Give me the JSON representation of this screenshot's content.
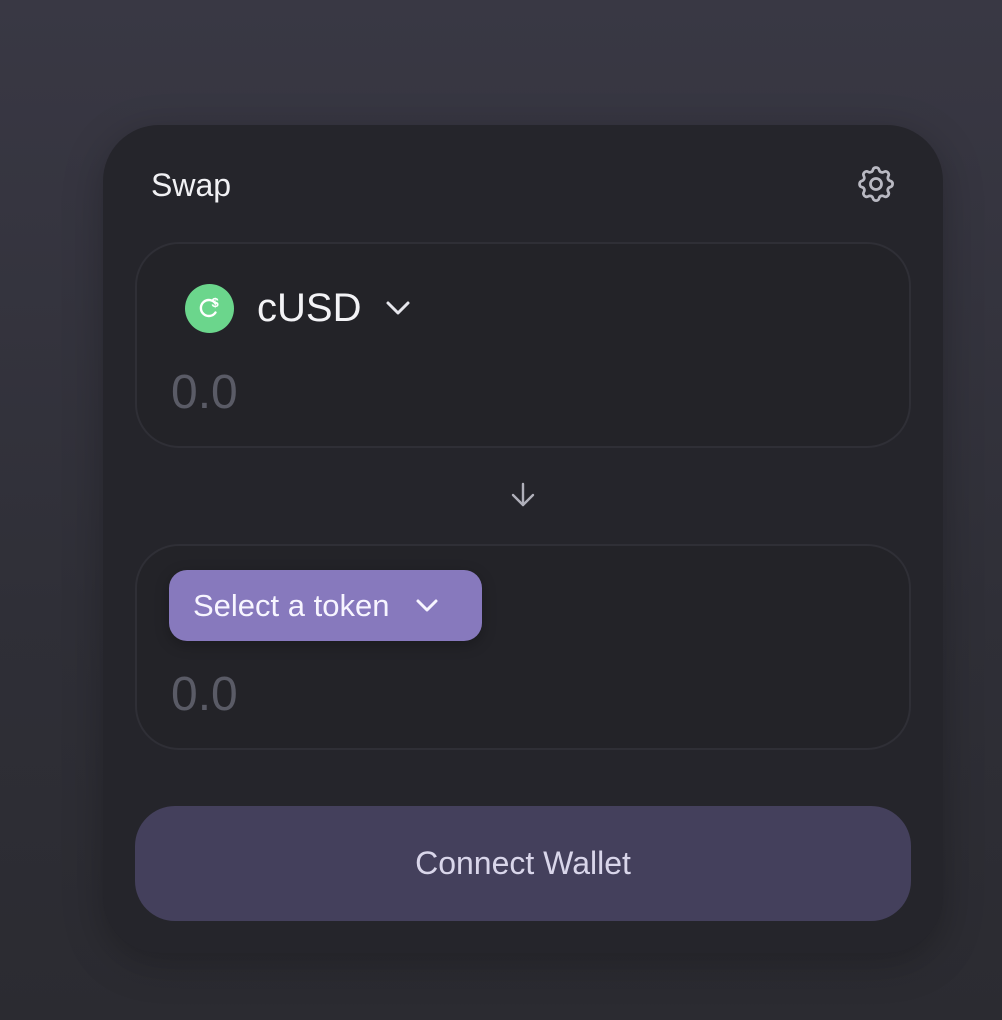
{
  "swap": {
    "title": "Swap",
    "settings_icon": "gear-icon"
  },
  "input_panel": {
    "token_icon": "celo-dollar-logo-icon",
    "token_symbol": "cUSD",
    "amount_placeholder": "0.0",
    "amount_value": ""
  },
  "switch": {
    "icon": "arrow-down-icon"
  },
  "output_panel": {
    "select_label": "Select a token",
    "amount_placeholder": "0.0",
    "amount_value": ""
  },
  "actions": {
    "connect_label": "Connect Wallet"
  },
  "colors": {
    "background": "#33333b",
    "card": "#25252b",
    "accent": "#8779bd",
    "connect_button": "#44405c",
    "token_green": "#6bd68c"
  }
}
